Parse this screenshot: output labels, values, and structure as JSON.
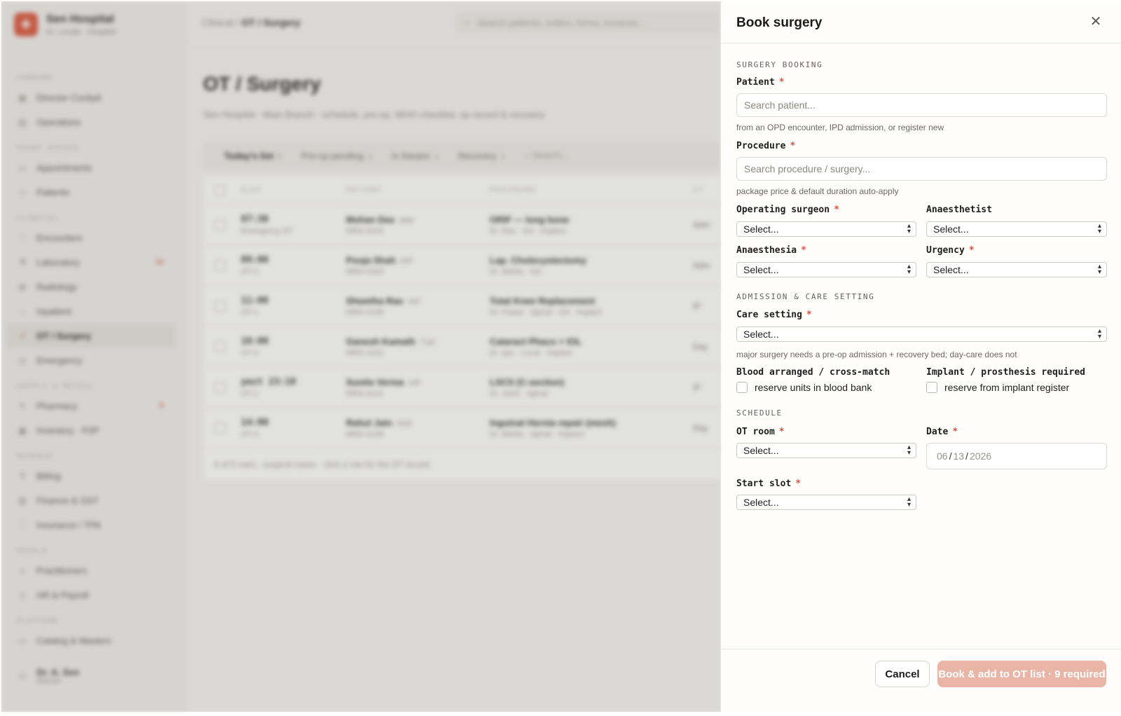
{
  "app": {
    "brand_name": "Sen Hospital",
    "brand_sub": "Dr. Locale · Hospital",
    "breadcrumb_root": "Clinical /",
    "breadcrumb_current": "OT / Surgery",
    "search_placeholder": "Search patients, orders, forms, invoices...",
    "sidebar": {
      "sections": [
        {
          "title": "COMMAND",
          "items": [
            {
              "label": "Director Cockpit",
              "icon": "▦"
            },
            {
              "label": "Operations",
              "icon": "▤"
            }
          ]
        },
        {
          "title": "FRONT OFFICE",
          "items": [
            {
              "label": "Appointments",
              "icon": "▭"
            },
            {
              "label": "Patients",
              "icon": "☺"
            }
          ]
        },
        {
          "title": "CLINICAL",
          "items": [
            {
              "label": "Encounters",
              "icon": "♡"
            },
            {
              "label": "Laboratory",
              "icon": "⚗",
              "badge": "12"
            },
            {
              "label": "Radiology",
              "icon": "⊠"
            },
            {
              "label": "Inpatient",
              "icon": "⌐"
            },
            {
              "label": "OT / Surgery",
              "icon": "∕",
              "active": true
            },
            {
              "label": "Emergency",
              "icon": "◎"
            }
          ]
        },
        {
          "title": "SUPPLY & RETAIL",
          "items": [
            {
              "label": "Pharmacy",
              "icon": "✎",
              "badge": "9"
            },
            {
              "label": "Inventory · P2P",
              "icon": "▣"
            }
          ]
        },
        {
          "title": "REVENUE",
          "items": [
            {
              "label": "Billing",
              "icon": "₹"
            },
            {
              "label": "Finance & GST",
              "icon": "▥"
            },
            {
              "label": "Insurance / TPA",
              "icon": "♡"
            }
          ]
        },
        {
          "title": "PEOPLE",
          "items": [
            {
              "label": "Practitioners",
              "icon": "☺"
            },
            {
              "label": "HR & Payroll",
              "icon": "☺"
            }
          ]
        },
        {
          "title": "PLATFORM",
          "items": [
            {
              "label": "Catalog & Masters",
              "icon": "▭"
            }
          ]
        }
      ],
      "user_name": "Dr. A. Sen",
      "user_role": "Director"
    },
    "main": {
      "title": "OT / Surgery",
      "subtitle": "Sen Hospital · Main Branch · schedule, pre-op, WHO checklist, op record & recovery",
      "tabs": [
        {
          "label": "Today's list",
          "count": "6"
        },
        {
          "label": "Pre-op pending",
          "count": "3"
        },
        {
          "label": "In theatre",
          "count": "1"
        },
        {
          "label": "Recovery",
          "count": "1"
        }
      ],
      "table_search_placeholder": "Search...",
      "columns": [
        "SLOT",
        "PATIENT",
        "PROCEDURE",
        "ST"
      ],
      "rows": [
        {
          "slot": "07:30",
          "room": "Emergency OT",
          "patient": "Mohan Das",
          "age": "38M",
          "mrn": "MRD-3104",
          "procedure": "ORIF — long bone",
          "detail": "Dr. Rao · GA · Implant",
          "status": "Adm"
        },
        {
          "slot": "09:00",
          "room": "OT-2",
          "patient": "Pooja Shah",
          "age": "45F",
          "mrn": "MRD-2420",
          "procedure": "Lap. Cholecystectomy",
          "detail": "Dr. Mehta · GA",
          "status": "Adm"
        },
        {
          "slot": "11:00",
          "room": "OT-1",
          "patient": "Shwetha Rao",
          "age": "44F",
          "mrn": "MRD-2108",
          "procedure": "Total Knee Replacement",
          "detail": "Dr. Pawar · Spinal · GA · Implant",
          "status": "IP"
        },
        {
          "slot": "10:00",
          "room": "OT-4",
          "patient": "Ganesh Kamath",
          "age": "71M",
          "mrn": "MRD-3102",
          "procedure": "Cataract Phaco + IOL",
          "detail": "Dr. Iyer · Local · Implant",
          "status": "Day"
        },
        {
          "slot": "yest 23:10",
          "room": "OT-1",
          "patient": "Sunita Verma",
          "age": "34F",
          "mrn": "MRD-3122",
          "procedure": "LSCS (C-section)",
          "detail": "Dr. Joshi · Spinal",
          "status": "IP"
        },
        {
          "slot": "14:00",
          "room": "OT-3",
          "patient": "Rahul Jain",
          "age": "52M",
          "mrn": "MRD-3158",
          "procedure": "Inguinal Hernia repair (mesh)",
          "detail": "Dr. Mehta · Spinal · Implant",
          "status": "Day"
        }
      ],
      "table_footer": "6 of 6 rows · surgical cases · click a row for the OT record"
    }
  },
  "drawer": {
    "title": "Book surgery",
    "sections": {
      "booking": "SURGERY BOOKING",
      "admission": "ADMISSION & CARE SETTING",
      "schedule": "SCHEDULE"
    },
    "required_mark": "*",
    "fields": {
      "patient": {
        "label": "Patient",
        "placeholder": "Search patient...",
        "hint": "from an OPD encounter, IPD admission, or register new"
      },
      "procedure": {
        "label": "Procedure",
        "placeholder": "Search procedure / surgery...",
        "hint": "package price & default duration auto-apply"
      },
      "surgeon": {
        "label": "Operating surgeon",
        "value": "Select..."
      },
      "anaesthetist": {
        "label": "Anaesthetist",
        "value": "Select..."
      },
      "anaesthesia": {
        "label": "Anaesthesia",
        "value": "Select..."
      },
      "urgency": {
        "label": "Urgency",
        "value": "Select..."
      },
      "care_setting": {
        "label": "Care setting",
        "value": "Select...",
        "hint": "major surgery needs a pre-op admission + recovery bed; day-care does not"
      },
      "blood": {
        "label": "Blood arranged / cross-match",
        "checkbox": "reserve units in blood bank"
      },
      "implant": {
        "label": "Implant / prosthesis required",
        "checkbox": "reserve from implant register"
      },
      "ot_room": {
        "label": "OT room",
        "value": "Select..."
      },
      "date": {
        "label": "Date",
        "mm": "06",
        "dd": "13",
        "yyyy": "2026",
        "sep": "/"
      },
      "start_slot": {
        "label": "Start slot",
        "value": "Select..."
      }
    },
    "buttons": {
      "cancel": "Cancel",
      "book": "Book & add to OT list · 9 required"
    }
  }
}
